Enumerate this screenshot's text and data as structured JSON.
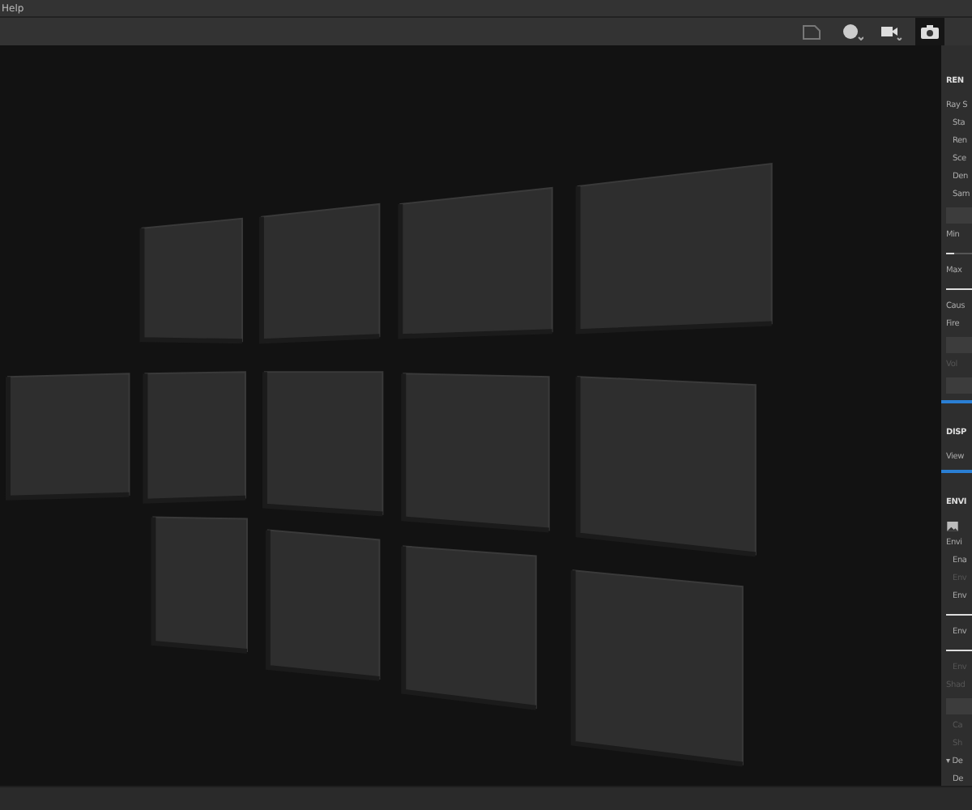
{
  "menu_bar": {
    "items": [
      "Help"
    ]
  },
  "toolbar": {
    "tools": [
      {
        "kind": "frame",
        "selected": false
      },
      {
        "kind": "sphere",
        "selected": false
      },
      {
        "kind": "video",
        "selected": false
      },
      {
        "kind": "camera",
        "selected": true
      }
    ]
  },
  "right_panel": {
    "sections": [
      {
        "title": "REN",
        "active": false,
        "rows": [
          {
            "kind": "label",
            "text": "Ray S",
            "disabled": false
          },
          {
            "kind": "sub",
            "text": "Sta",
            "disabled": false
          },
          {
            "kind": "sub",
            "text": "Ren",
            "disabled": false
          },
          {
            "kind": "sub",
            "text": "Sce",
            "disabled": false
          },
          {
            "kind": "sub",
            "text": "Den",
            "disabled": false
          },
          {
            "kind": "sub",
            "text": "Sam",
            "disabled": false
          },
          {
            "kind": "box"
          },
          {
            "kind": "label",
            "text": "Min",
            "disabled": false
          },
          {
            "kind": "slider",
            "level": 0.3
          },
          {
            "kind": "label",
            "text": "Max",
            "disabled": false
          },
          {
            "kind": "slider",
            "level": 1
          },
          {
            "kind": "label",
            "text": "Caus",
            "disabled": false
          },
          {
            "kind": "label",
            "text": "Fire",
            "disabled": false
          },
          {
            "kind": "box"
          },
          {
            "kind": "label",
            "text": "Vol",
            "disabled": true
          },
          {
            "kind": "box"
          }
        ]
      },
      {
        "title": "DISP",
        "active": true,
        "rows": [
          {
            "kind": "label",
            "text": "View",
            "disabled": false
          }
        ]
      },
      {
        "title": "ENVI",
        "active": true,
        "rows": [
          {
            "kind": "label",
            "text": "Envi",
            "disabled": false
          },
          {
            "kind": "sub",
            "text": "Ena",
            "disabled": false
          },
          {
            "kind": "sub",
            "text": "Env",
            "disabled": true
          },
          {
            "kind": "sub",
            "text": "Env",
            "disabled": false
          },
          {
            "kind": "slider",
            "level": 1
          },
          {
            "kind": "sub",
            "text": "Env",
            "disabled": false
          },
          {
            "kind": "slider",
            "level": 1
          },
          {
            "kind": "sub",
            "text": "Env",
            "disabled": true
          },
          {
            "kind": "label",
            "text": "Shad",
            "disabled": true
          },
          {
            "kind": "box"
          },
          {
            "kind": "sub",
            "text": "Ca",
            "disabled": true
          },
          {
            "kind": "sub",
            "text": "Sh",
            "disabled": true
          },
          {
            "kind": "label",
            "text": "▾ De",
            "disabled": false
          },
          {
            "kind": "sub",
            "text": "De",
            "disabled": false
          }
        ]
      }
    ]
  }
}
